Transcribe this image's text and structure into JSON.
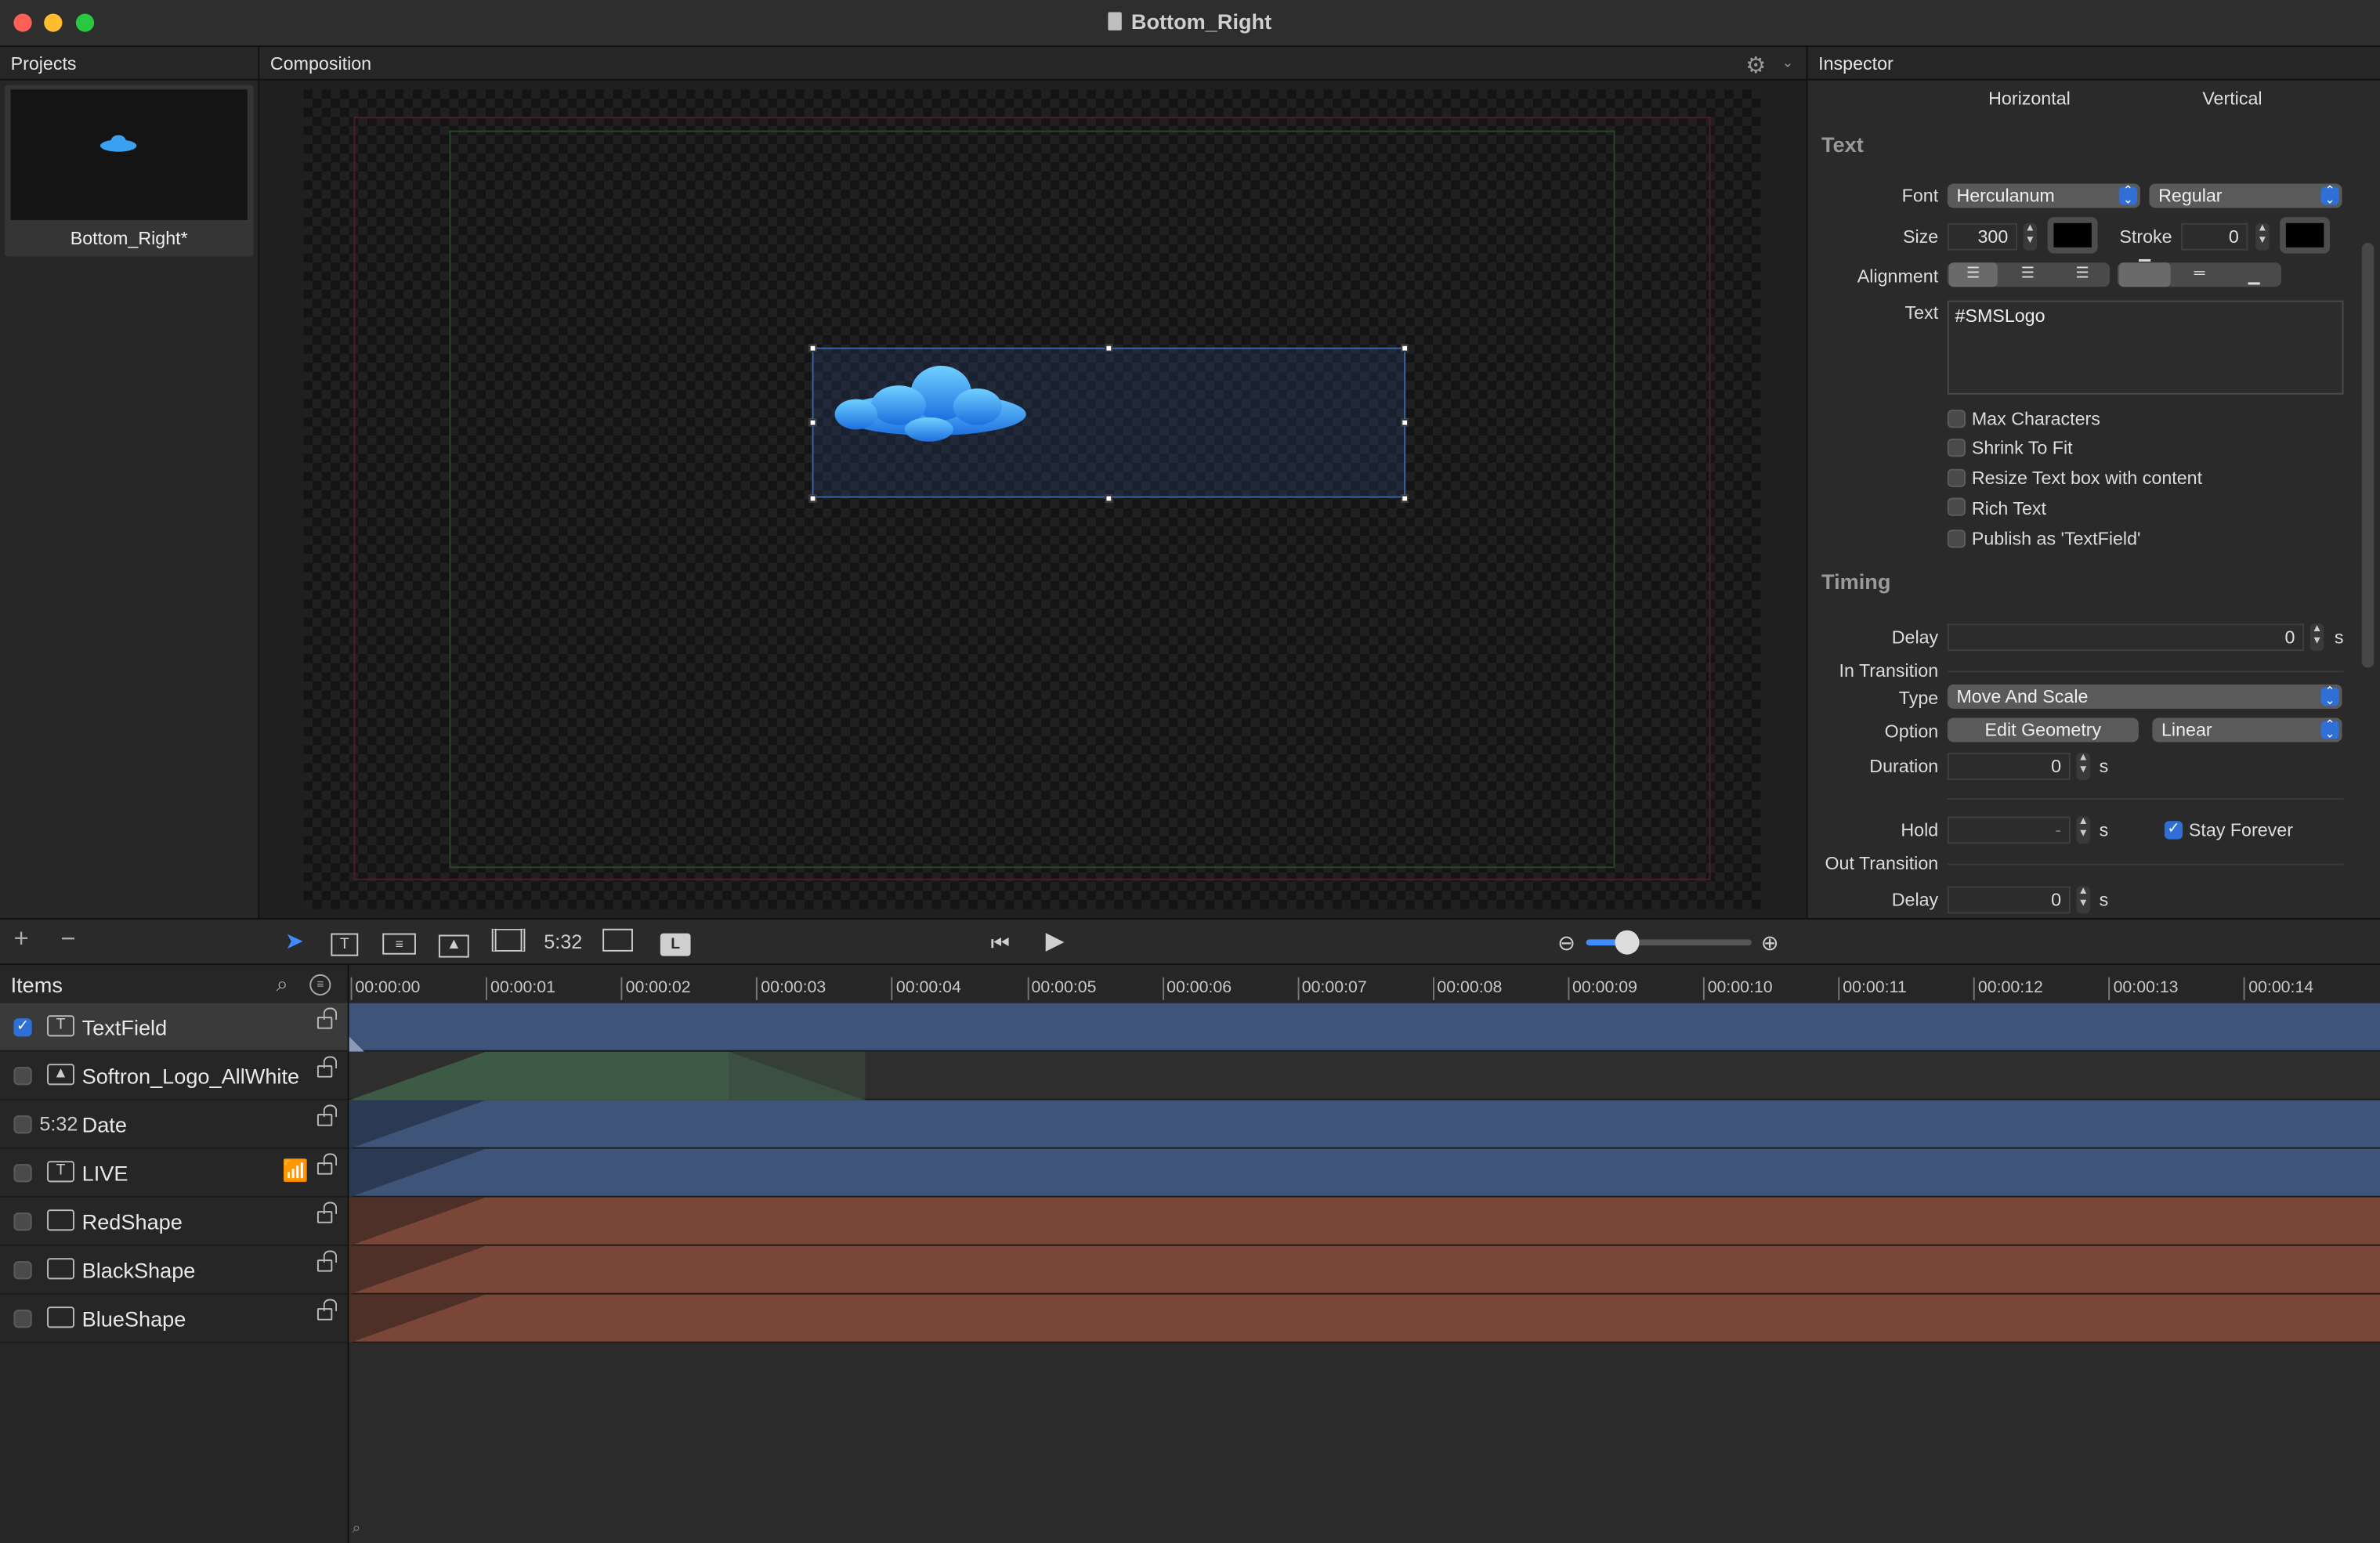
{
  "window": {
    "title": "Bottom_Right"
  },
  "colors": {
    "accent": "#2f6fd6",
    "track_blue": "#3e5478",
    "track_red": "#7a4638",
    "track_green": "#3c5a44"
  },
  "projects": {
    "header": "Projects",
    "items": [
      {
        "name": "Bottom_Right*"
      }
    ]
  },
  "composition": {
    "header": "Composition"
  },
  "inspector": {
    "header": "Inspector",
    "tabs": [
      "Horizontal",
      "Vertical"
    ],
    "text_section": {
      "title": "Text",
      "font_label": "Font",
      "font_value": "Herculanum",
      "style_value": "Regular",
      "size_label": "Size",
      "size_value": "300",
      "stroke_label": "Stroke",
      "stroke_value": "0",
      "alignment_label": "Alignment",
      "text_label": "Text",
      "text_value": "#SMSLogo",
      "checkboxes": [
        {
          "label": "Max Characters",
          "checked": false
        },
        {
          "label": "Shrink To Fit",
          "checked": false
        },
        {
          "label": "Resize Text box with content",
          "checked": false
        },
        {
          "label": "Rich Text",
          "checked": false
        },
        {
          "label": "Publish as 'TextField'",
          "checked": false
        }
      ]
    },
    "timing": {
      "title": "Timing",
      "delay_label": "Delay",
      "delay_value": "0",
      "unit": "s",
      "in_transition_label": "In Transition",
      "type_label": "Type",
      "type_value": "Move And Scale",
      "option_label": "Option",
      "option_button": "Edit Geometry",
      "option_value": "Linear",
      "duration_label": "Duration",
      "duration_value": "0",
      "hold_label": "Hold",
      "hold_value": "-",
      "stay_forever_label": "Stay Forever",
      "stay_forever_checked": true,
      "out_transition_label": "Out Transition",
      "out_delay_label": "Delay",
      "out_delay_value": "0"
    }
  },
  "toolbar": {
    "add": "+",
    "remove": "−",
    "clock_tool": "5:32",
    "l_tool": "L"
  },
  "items_panel": {
    "header": "Items",
    "rows": [
      {
        "name": "TextField",
        "icon": "text-icon",
        "checked": true
      },
      {
        "name": "Softron_Logo_AllWhite",
        "icon": "image-icon",
        "checked": false
      },
      {
        "name": "Date",
        "icon": "clock-icon",
        "icon_text": "5:32",
        "checked": false
      },
      {
        "name": "LIVE",
        "icon": "text-icon",
        "checked": false
      },
      {
        "name": "RedShape",
        "icon": "rectangle-icon",
        "checked": false
      },
      {
        "name": "BlackShape",
        "icon": "rectangle-icon",
        "checked": false
      },
      {
        "name": "BlueShape",
        "icon": "rectangle-icon",
        "checked": false
      }
    ]
  },
  "timeline": {
    "ruler": [
      "00:00:00",
      "00:00:01",
      "00:00:02",
      "00:00:03",
      "00:00:04",
      "00:00:05",
      "00:00:06",
      "00:00:07",
      "00:00:08",
      "00:00:09",
      "00:00:10",
      "00:00:11",
      "00:00:12",
      "00:00:13",
      "00:00:14"
    ]
  }
}
